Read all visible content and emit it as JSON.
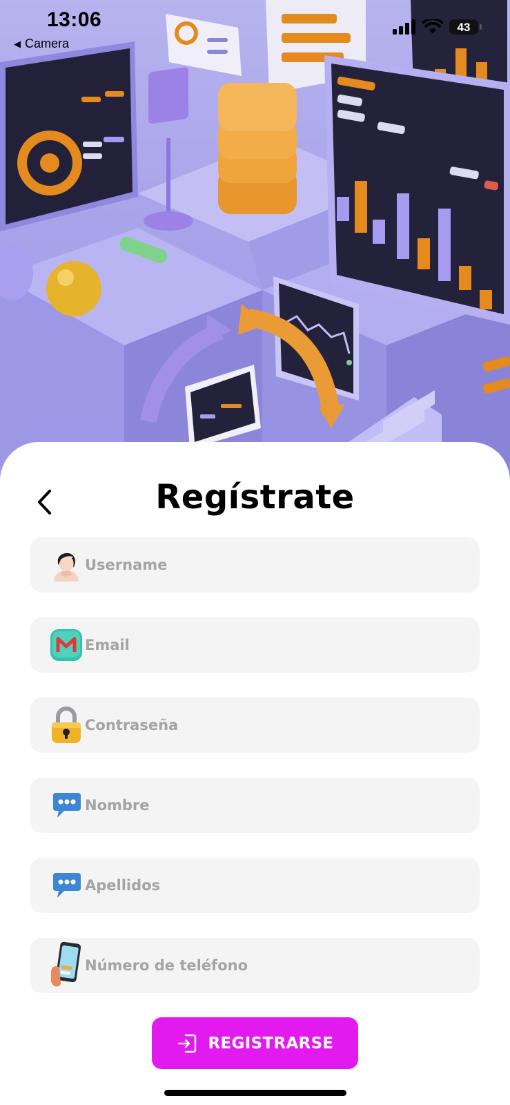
{
  "status_bar": {
    "time": "13:06",
    "back_app": "Camera",
    "battery": "43"
  },
  "colors": {
    "accent": "#e21af0",
    "field_bg": "#f4f4f4",
    "placeholder": "#a4a4a4",
    "hero_bg": "#aaa5eb"
  },
  "hero": {
    "icon": "isometric-dashboard-illustration"
  },
  "header": {
    "title": "Regístrate",
    "back_icon": "chevron-left-icon"
  },
  "form": {
    "fields": [
      {
        "icon": "user-avatar-icon",
        "placeholder": "Username"
      },
      {
        "icon": "gmail-icon",
        "placeholder": "Email"
      },
      {
        "icon": "padlock-icon",
        "placeholder": "Contraseña"
      },
      {
        "icon": "chat-bubble-icon",
        "placeholder": "Nombre"
      },
      {
        "icon": "chat-bubble-icon",
        "placeholder": "Apellidos"
      },
      {
        "icon": "smartphone-icon",
        "placeholder": "Número de teléfono"
      }
    ],
    "submit": {
      "icon": "login-icon",
      "label": "REGISTRARSE"
    }
  }
}
